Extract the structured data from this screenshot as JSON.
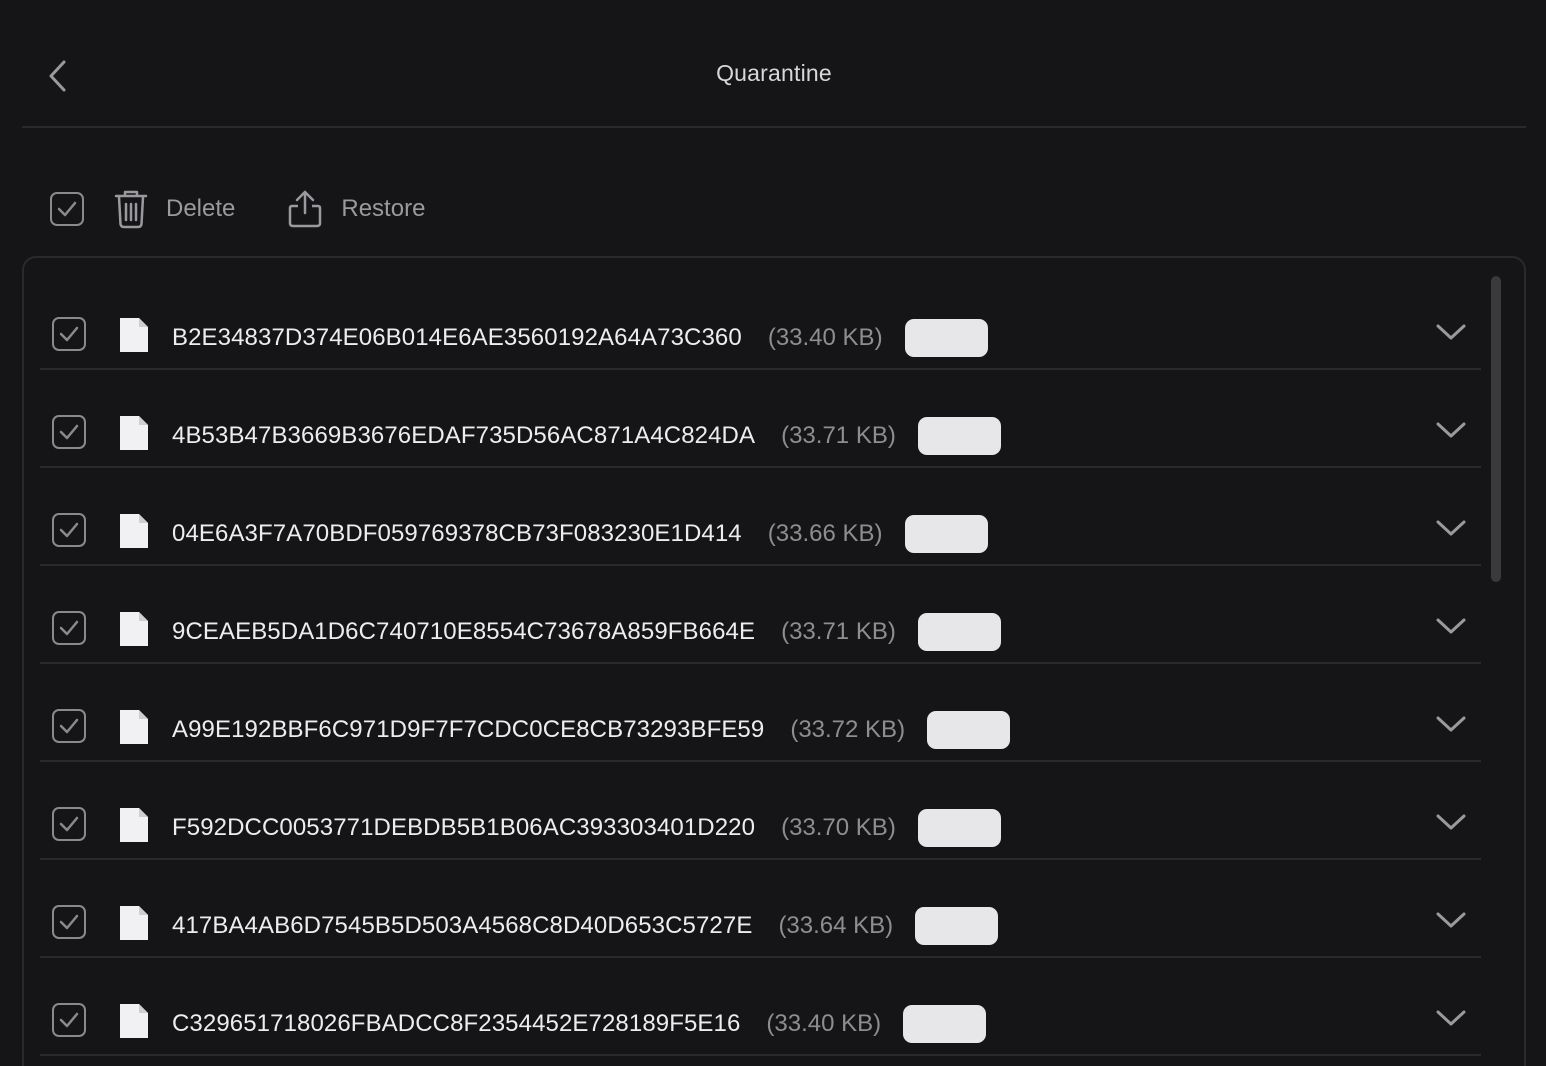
{
  "header": {
    "title": "Quarantine"
  },
  "toolbar": {
    "delete_label": "Delete",
    "restore_label": "Restore"
  },
  "files": [
    {
      "name": "B2E34837D374E06B014E6AE3560192A64A73C360",
      "size": "(33.40 KB)",
      "tag": ""
    },
    {
      "name": "4B53B47B3669B3676EDAF735D56AC871A4C824DA",
      "size": "(33.71 KB)",
      "tag": ""
    },
    {
      "name": "04E6A3F7A70BDF059769378CB73F083230E1D414",
      "size": "(33.66 KB)",
      "tag": ""
    },
    {
      "name": "9CEAEB5DA1D6C740710E8554C73678A859FB664E",
      "size": "(33.71 KB)",
      "tag": ""
    },
    {
      "name": "A99E192BBF6C971D9F7F7CDC0CE8CB73293BFE59",
      "size": "(33.72 KB)",
      "tag": ""
    },
    {
      "name": "F592DCC0053771DEBDB5B1B06AC393303401D220",
      "size": "(33.70 KB)",
      "tag": ""
    },
    {
      "name": "417BA4AB6D7545B5D503A4568C8D40D653C5727E",
      "size": "(33.64 KB)",
      "tag": ""
    },
    {
      "name": "C329651718026FBADCC8F2354452E728189F5E16",
      "size": "(33.40 KB)",
      "tag": ""
    }
  ]
}
